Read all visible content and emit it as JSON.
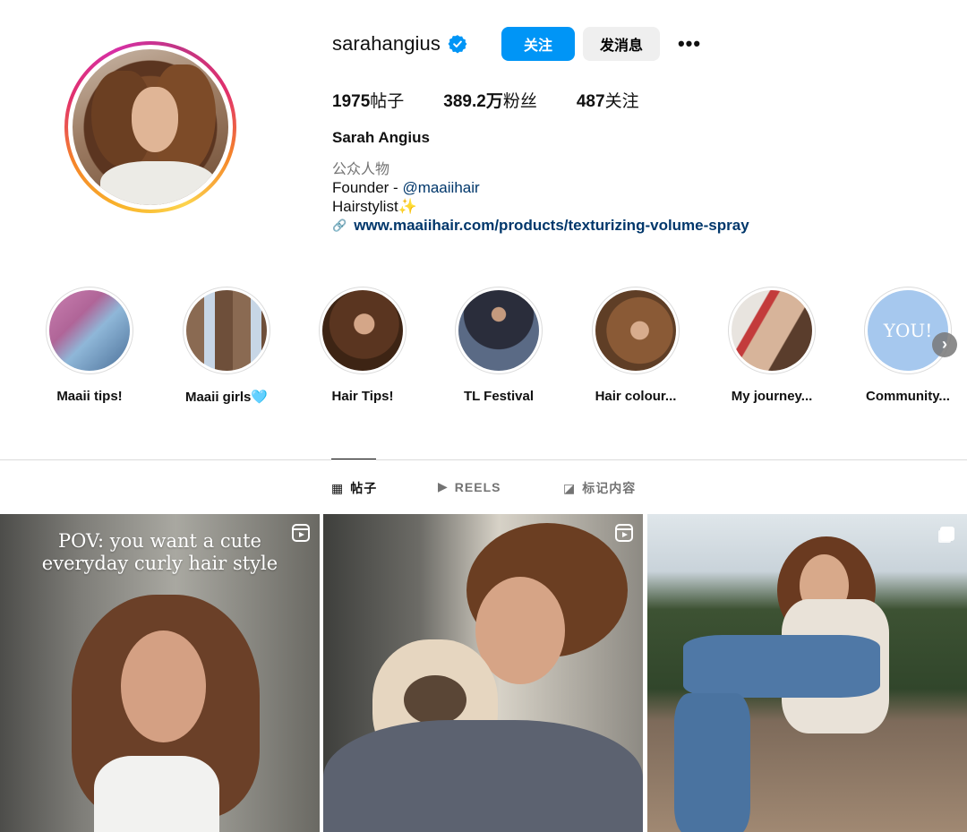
{
  "profile": {
    "username": "sarahangius",
    "verified": true,
    "follow_label": "关注",
    "message_label": "发消息",
    "more_label": "•••",
    "stats": {
      "posts_num": "1975",
      "posts_label": "帖子",
      "followers_num": "389.2万",
      "followers_label": "粉丝",
      "following_num": "487",
      "following_label": "关注"
    },
    "full_name": "Sarah Angius",
    "category": "公众人物",
    "bio_line1_prefix": "Founder - ",
    "bio_mention": "@maaiihair",
    "bio_line2": "Hairstylist✨",
    "website": "www.maaiihair.com/products/texturizing-volume-spray"
  },
  "highlights": [
    {
      "label": "Maaii tips!"
    },
    {
      "label": "Maaii girls🩵"
    },
    {
      "label": "Hair Tips!"
    },
    {
      "label": "TL Festival"
    },
    {
      "label": "Hair colour..."
    },
    {
      "label": "My journey..."
    },
    {
      "label": "Community...",
      "cover_text": "YOU!"
    }
  ],
  "tabs": [
    {
      "label": "帖子",
      "icon": "grid-icon",
      "active": true
    },
    {
      "label": "REELS",
      "icon": "reels-icon",
      "active": false
    },
    {
      "label": "标记内容",
      "icon": "tagged-icon",
      "active": false
    }
  ],
  "posts": [
    {
      "type": "reel",
      "caption": "POV: you want a cute everyday curly hair style"
    },
    {
      "type": "reel",
      "caption": ""
    },
    {
      "type": "carousel",
      "caption": ""
    }
  ],
  "colors": {
    "accent": "#0095f6",
    "link": "#00376b",
    "secondary_text": "#737373",
    "border": "#dbdbdb"
  }
}
